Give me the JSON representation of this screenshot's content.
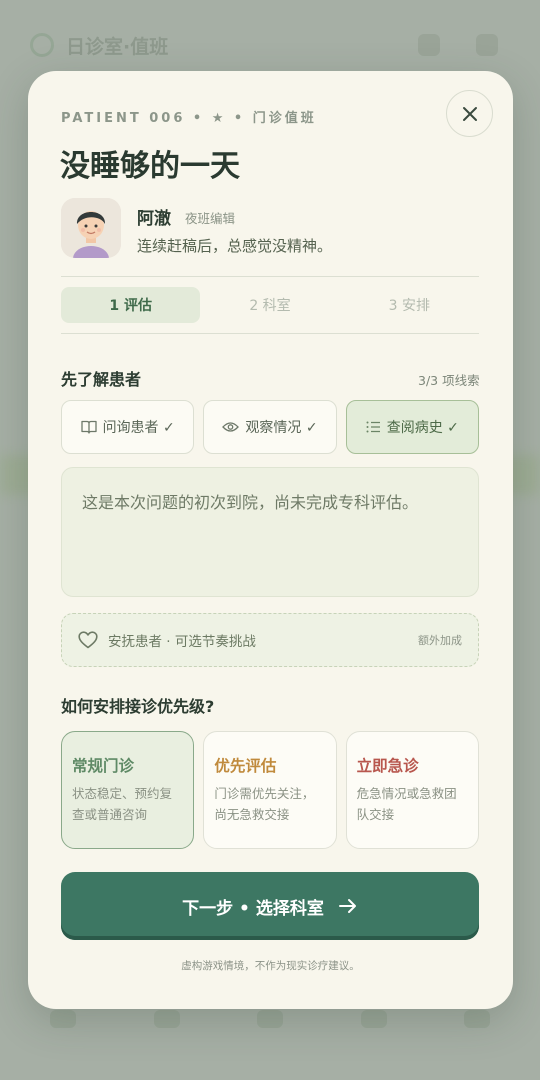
{
  "background": {
    "app_title": "日诊室·值班"
  },
  "modal": {
    "eyebrow": "PATIENT 006 • ★ • 门诊值班",
    "title": "没睡够的一天",
    "patient": {
      "name": "阿澈",
      "role": "夜班编辑",
      "description": "连续赶稿后，总感觉没精神。"
    },
    "steps": [
      {
        "label": "1 评估",
        "active": true
      },
      {
        "label": "2 科室",
        "active": false
      },
      {
        "label": "3 安排",
        "active": false
      }
    ],
    "clue_section": {
      "title": "先了解患者",
      "count": "3/3 项线索",
      "actions": [
        {
          "label": "问询患者 ✓",
          "icon": "book-icon",
          "selected": false
        },
        {
          "label": "观察情况 ✓",
          "icon": "eye-icon",
          "selected": false
        },
        {
          "label": "查阅病史 ✓",
          "icon": "list-icon",
          "selected": true
        }
      ],
      "info_text": "这是本次问题的初次到院，尚未完成专科评估。"
    },
    "bonus": {
      "icon": "heart-icon",
      "label": "安抚患者 · 可选节奏挑战",
      "tag": "额外加成"
    },
    "priority_section": {
      "title": "如何安排接诊优先级?",
      "options": [
        {
          "title": "常规门诊",
          "desc": "状态稳定、预约复查或普通咨询",
          "color": "#5f8a66",
          "selected": true
        },
        {
          "title": "优先评估",
          "desc": "门诊需优先关注，尚无急救交接",
          "color": "#c08a3c",
          "selected": false
        },
        {
          "title": "立即急诊",
          "desc": "危急情况或急救团队交接",
          "color": "#b8574e",
          "selected": false
        }
      ]
    },
    "next_button": {
      "label": "下一步 • 选择科室",
      "icon": "arrow-right-icon"
    },
    "disclaimer": "虚构游戏情境，不作为现实诊疗建议。"
  },
  "colors": {
    "primary": "#3d7763",
    "accent_green": "#5f8a66",
    "accent_amber": "#c08a3c",
    "accent_red": "#b8574e",
    "card_bg": "#f8f6ec"
  }
}
